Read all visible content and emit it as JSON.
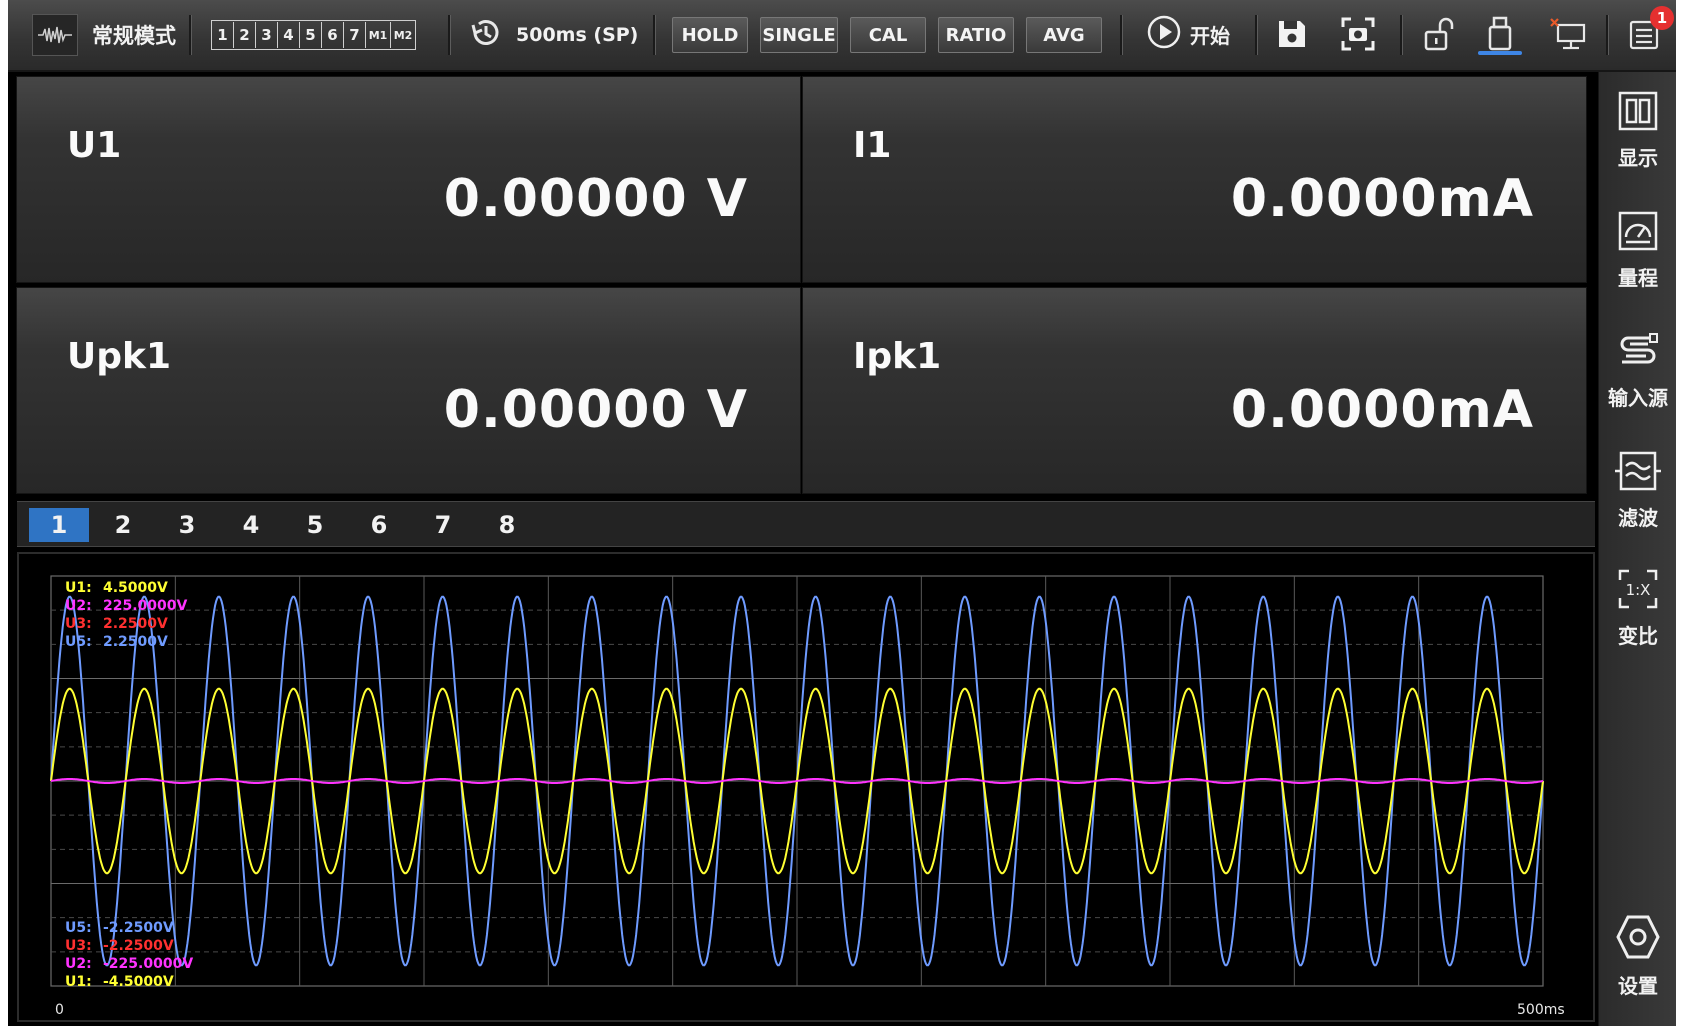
{
  "toolbar": {
    "mode_label": "常规模式",
    "channels": [
      "1",
      "2",
      "3",
      "4",
      "5",
      "6",
      "7",
      "M1",
      "M2"
    ],
    "update_rate": "500ms (SP)",
    "buttons": [
      "HOLD",
      "SINGLE",
      "CAL",
      "RATIO",
      "AVG"
    ],
    "start_label": "开始",
    "notification_count": "1",
    "icons": [
      "waveform-icon",
      "history-icon",
      "play-icon",
      "save-icon",
      "screenshot-icon",
      "unlock-icon",
      "usb-drive-icon",
      "network-disconnected-icon",
      "menu-list-icon"
    ],
    "accent_color": "#3e86e6",
    "badge_color": "#e53030"
  },
  "panels": [
    {
      "name": "U1",
      "value": "0.00000 V"
    },
    {
      "name": "I1",
      "value": "0.0000mA"
    },
    {
      "name": "Upk1",
      "value": "0.00000 V"
    },
    {
      "name": "Ipk1",
      "value": "0.0000mA"
    }
  ],
  "tabs": [
    "1",
    "2",
    "3",
    "4",
    "5",
    "6",
    "7",
    "8"
  ],
  "active_tab": "1",
  "waveform": {
    "top_labels": [
      {
        "tag": "U1:",
        "value": "4.5000V",
        "color": "#ffff33"
      },
      {
        "tag": "U2:",
        "value": "225.0000V",
        "color": "#ff33ff"
      },
      {
        "tag": "U3:",
        "value": "2.2500V",
        "color": "#ff3030"
      },
      {
        "tag": "U5:",
        "value": "2.2500V",
        "color": "#6f9bff"
      }
    ],
    "bottom_labels": [
      {
        "tag": "U5:",
        "value": "-2.2500V",
        "color": "#6f9bff"
      },
      {
        "tag": "U3:",
        "value": "-2.2500V",
        "color": "#ff3030"
      },
      {
        "tag": "U2:",
        "value": "-225.0000V",
        "color": "#ff33ff"
      },
      {
        "tag": "U1:",
        "value": "-4.5000V",
        "color": "#ffff33"
      }
    ],
    "x_start": "0",
    "x_end": "500ms",
    "cycles": 20,
    "series": [
      {
        "name": "U5",
        "color": "#6f9bff",
        "amplitude_fraction": 0.9
      },
      {
        "name": "U1",
        "color": "#ffff33",
        "amplitude_fraction": 0.45
      },
      {
        "name": "U2",
        "color": "#ff33ff",
        "amplitude_fraction": 0.01
      }
    ]
  },
  "sidebar": [
    {
      "label": "显示",
      "icon": "display-layout-icon"
    },
    {
      "label": "量程",
      "icon": "range-gauge-icon"
    },
    {
      "label": "输入源",
      "icon": "input-source-icon"
    },
    {
      "label": "滤波",
      "icon": "filter-wave-icon"
    },
    {
      "label": "变比",
      "icon": "ratio-icon"
    },
    {
      "label": "设置",
      "icon": "settings-hexagon-icon"
    }
  ]
}
